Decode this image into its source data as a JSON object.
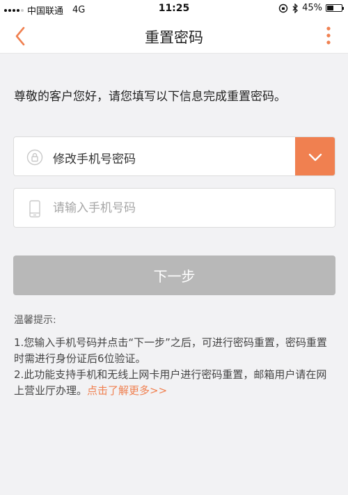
{
  "status_bar": {
    "carrier": "中国联通",
    "network": "4G",
    "time": "11:25",
    "battery": "45%",
    "battery_level": 0.45
  },
  "nav": {
    "title": "重置密码",
    "back_icon": "chevron-left-icon",
    "more_icon": "more-vertical-icon"
  },
  "intro_text": "尊敬的客户您好，请您填写以下信息完成重置密码。",
  "form": {
    "action_select": {
      "value": "修改手机号密码",
      "icon": "lock-icon",
      "arrow_icon": "chevron-down-icon"
    },
    "phone_input": {
      "value": "",
      "placeholder": "请输入手机号码",
      "icon": "phone-icon"
    },
    "next_button": "下一步"
  },
  "tips": {
    "title": "温馨提示:",
    "line1": "1.您输入手机号码并点击“下一步”之后，可进行密码重置，密码重置时需进行身份证后6位验证。",
    "line2": "2.此功能支持手机和无线上网卡用户进行密码重置，邮箱用户请在网上营业厅办理。",
    "link": "点击了解更多>>"
  },
  "colors": {
    "accent": "#f08050",
    "disabled_button": "#b8b8b8",
    "background": "#f2f2f4"
  }
}
